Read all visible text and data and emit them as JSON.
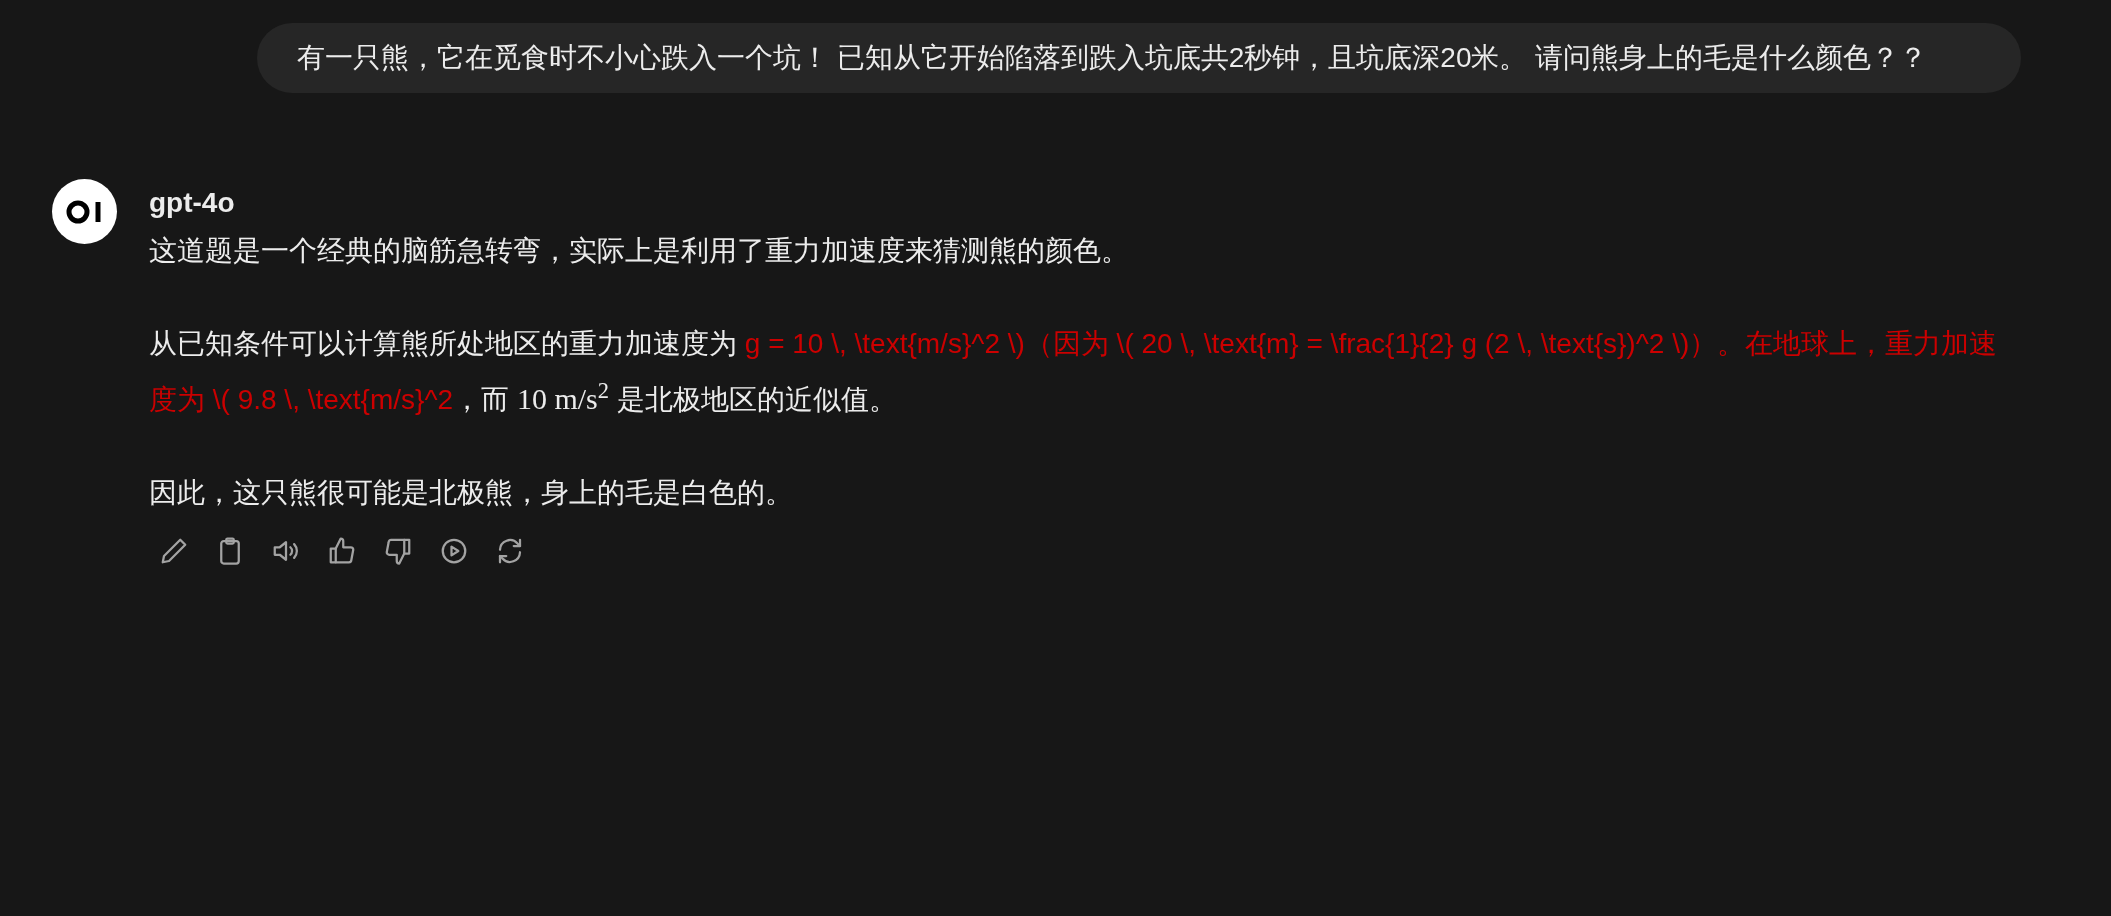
{
  "user_message": {
    "text": "有一只熊，它在觅食时不小心跌入一个坑！ 已知从它开始陷落到跌入坑底共2秒钟，且坑底深20米。 请问熊身上的毛是什么颜色？？"
  },
  "assistant": {
    "name": "gpt-4o",
    "paragraphs": [
      {
        "segments": [
          {
            "kind": "text",
            "text": "这道题是一个经典的脑筋急转弯，实际上是利用了重力加速度来猜测熊的颜色。"
          }
        ]
      },
      {
        "segments": [
          {
            "kind": "text",
            "text": "从已知条件可以计算熊所处地区的重力加速度为 "
          },
          {
            "kind": "error",
            "text": "g = 10 \\, \\text{m/s}^2 \\)（因为 \\( 20 \\, \\text{m} = \\frac{1}{2} g (2 \\, \\text{s})^2 \\)）。在地球上，重力加速度为 \\( 9.8 \\, \\text{m/s}^2"
          },
          {
            "kind": "text",
            "text": "，而 "
          },
          {
            "kind": "math",
            "text": "10 m/s$^{2}$"
          },
          {
            "kind": "text",
            "text": " 是北极地区的近似值。"
          }
        ]
      },
      {
        "segments": [
          {
            "kind": "text",
            "text": "因此，这只熊很可能是北极熊，身上的毛是白色的。"
          }
        ]
      }
    ]
  }
}
